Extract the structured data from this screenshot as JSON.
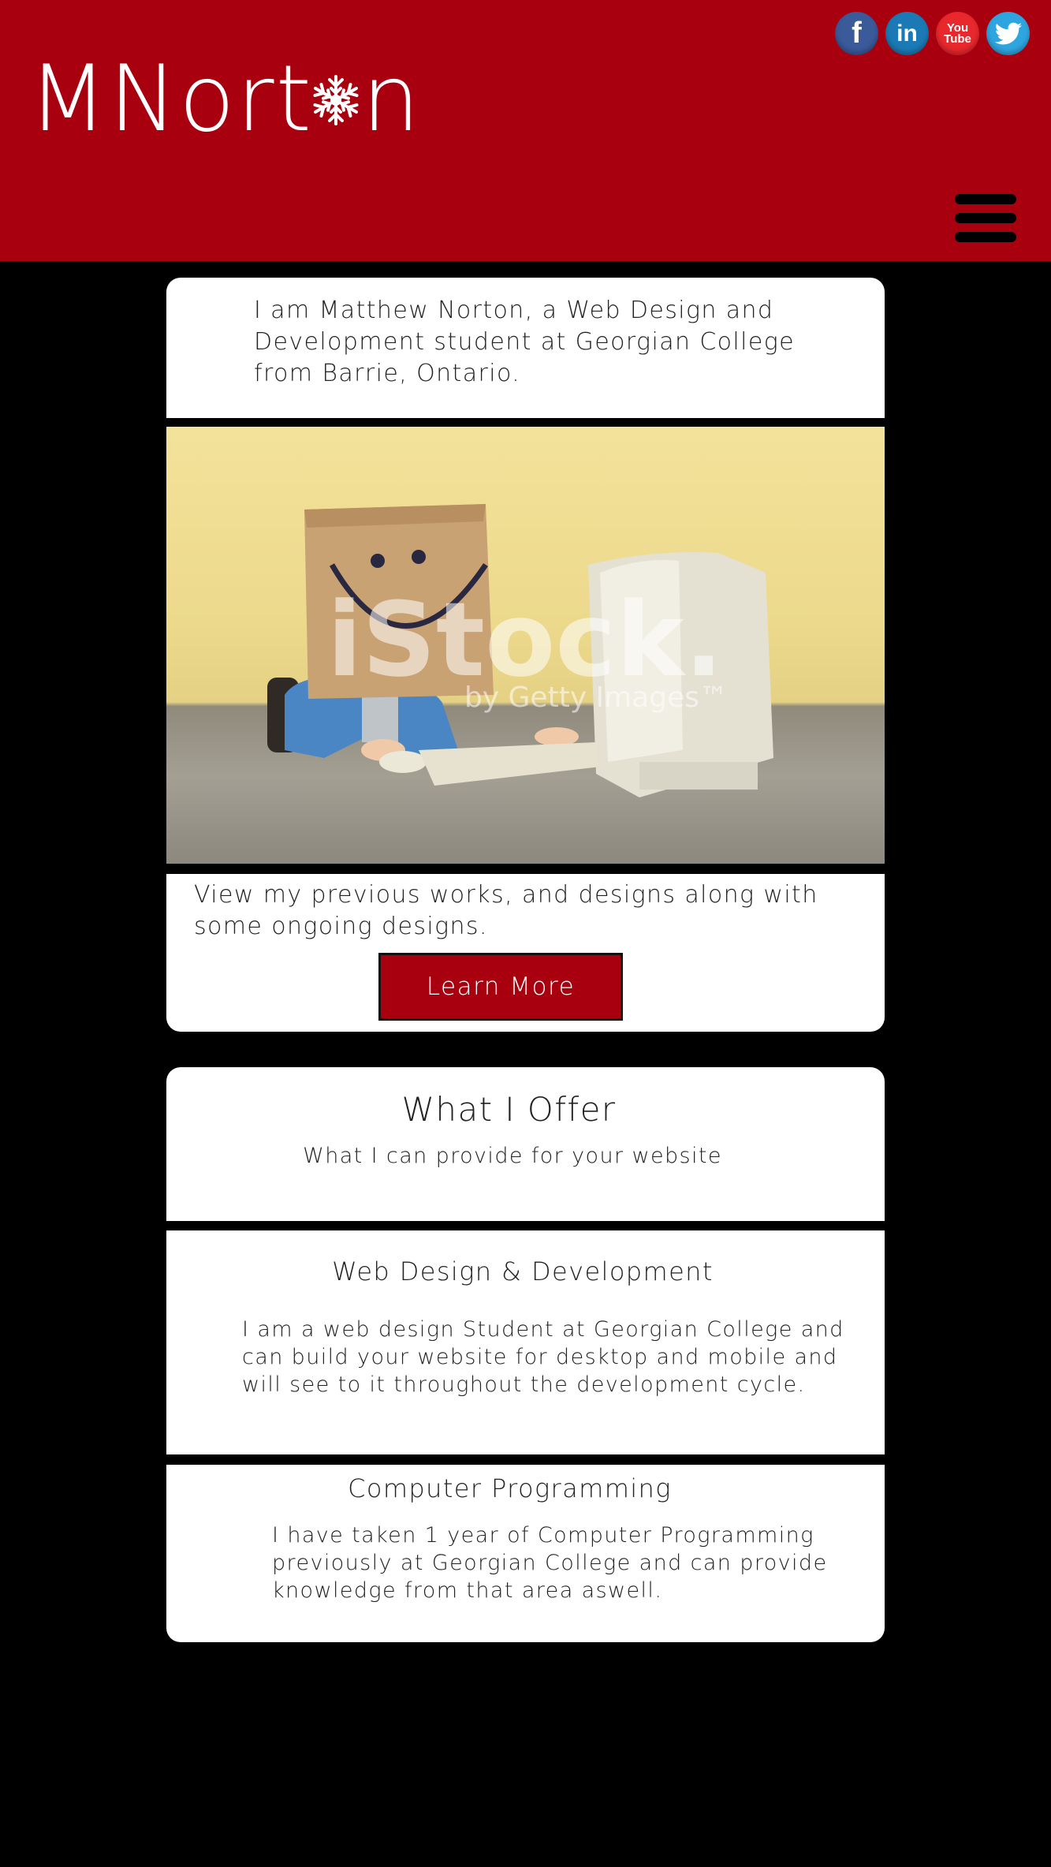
{
  "header": {
    "logo_text_left": "MNort",
    "logo_text_right": "n",
    "social": {
      "facebook": "f",
      "linkedin": "in",
      "youtube_top": "You",
      "youtube_bottom": "Tube"
    },
    "colors": {
      "brand": "#a8000f",
      "page_bg": "#000000"
    }
  },
  "intro": {
    "text": "I am Matthew Norton, a Web Design and Development student at Georgian College from Barrie, Ontario."
  },
  "hero_image": {
    "watermark": "iStock.",
    "watermark_sub": "by Getty Images™"
  },
  "works": {
    "text": "View my previous works, and designs along with some ongoing designs.",
    "button_label": "Learn More"
  },
  "offer": {
    "title": "What I Offer",
    "subtitle": "What I can provide for your website"
  },
  "services": [
    {
      "title": "Web Design & Development",
      "text": "I am a web design Student at Georgian College and can build your website for desktop and mobile and will see to it throughout the development cycle."
    },
    {
      "title": "Computer Programming",
      "text": "I have taken 1 year of Computer Programming previously at Georgian College and can provide knowledge from that area aswell."
    }
  ]
}
